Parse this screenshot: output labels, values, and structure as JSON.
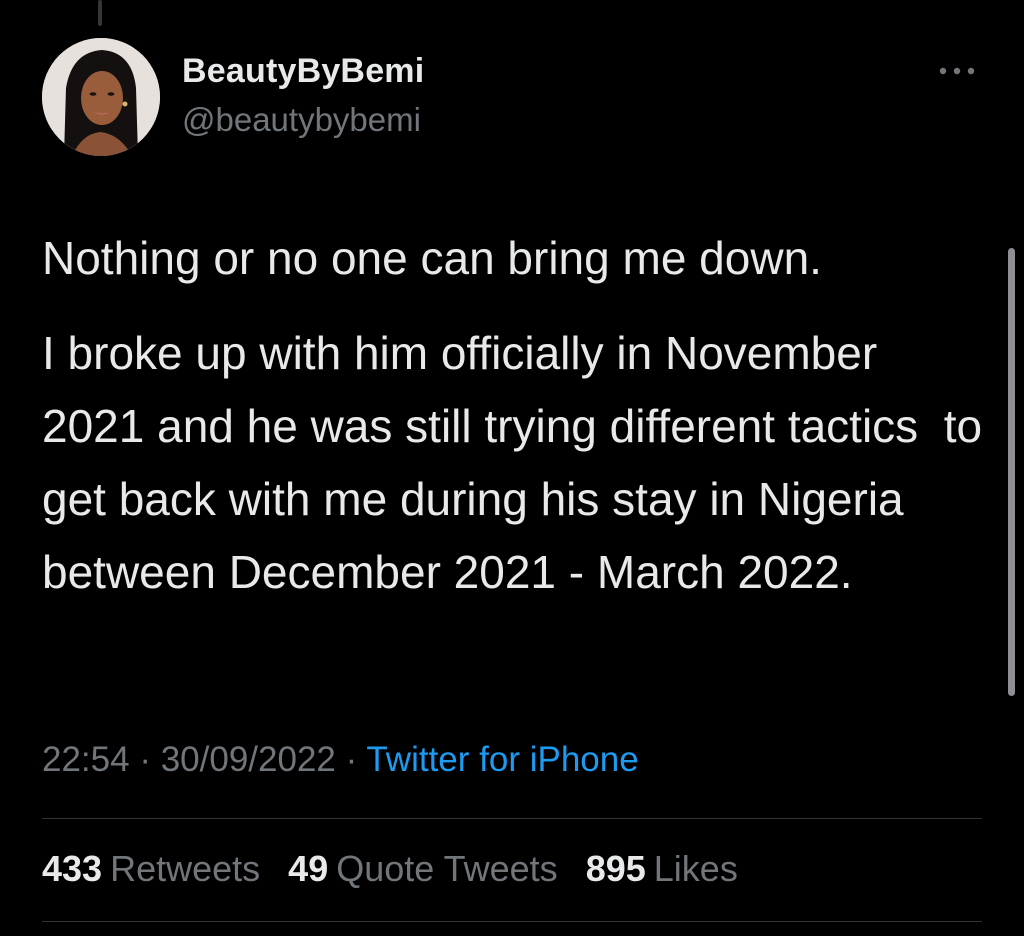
{
  "tweet": {
    "author": {
      "display_name": "BeautyByBemi",
      "handle": "@beautybybemi"
    },
    "text_paragraphs": [
      "Nothing or no one can bring me down.",
      "I broke up with him officially in November 2021 and he was still trying different tactics  to get back with me during his stay in Nigeria between December 2021 - March 2022."
    ],
    "time": "22:54",
    "date": "30/09/2022",
    "separator": " · ",
    "source": "Twitter for iPhone",
    "stats": {
      "retweets_count": "433",
      "retweets_label": "Retweets",
      "quotes_count": "49",
      "quotes_label": "Quote Tweets",
      "likes_count": "895",
      "likes_label": "Likes"
    }
  },
  "icons": {
    "more": "more-horizontal-icon"
  },
  "colors": {
    "background": "#000000",
    "primary_text": "#e7e9ea",
    "secondary_text": "#71767b",
    "accent": "#1d9bf0",
    "divider": "#2f3336"
  }
}
